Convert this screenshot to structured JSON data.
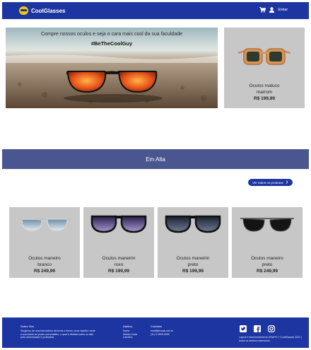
{
  "header": {
    "brand": "CoolGlasses",
    "login_label": "Entrar",
    "color": "#1d35a1"
  },
  "hero": {
    "headline": "Compre nossos oculos e seja o cara mais cool da sua faculdade",
    "hashtag": "#BeTheCoolGuy"
  },
  "featured_side": {
    "name_line1": "Oculos maluco",
    "name_line2": "marrom",
    "price": "R$ 199,99"
  },
  "section": {
    "title": "Em Alta",
    "see_all_label": "Ver todos os produtos"
  },
  "products": [
    {
      "name_line1": "Oculos maneiro",
      "name_line2": "branco",
      "price": "R$ 249,99",
      "style": "aviator-blue"
    },
    {
      "name_line1": "Oculos maneirin",
      "name_line2": "roxo",
      "price": "R$ 199,99",
      "style": "wayfarer-purple"
    },
    {
      "name_line1": "Oculos maneirin",
      "name_line2": "preto",
      "price": "R$ 199,99",
      "style": "wayfarer-black"
    },
    {
      "name_line1": "Oculos maneiro",
      "name_line2": "preto",
      "price": "R$ 249,99",
      "style": "aviator-black"
    }
  ],
  "footer": {
    "about_title": "Sobre Nós",
    "about_text": "Surgimos de uma brincadeira da turma e temos como objetivo vestir a sua mente de jovem universitário, o qual é dividido todos os dias pela universidade e profissões",
    "links_title": "Atalhos",
    "links": [
      "Home",
      "Minha Conta",
      "Carrinho"
    ],
    "contact_title": "Contatos",
    "contact_email": "email@email.com.br",
    "contact_phone": "(11) 9 9999-9999",
    "copyright": "Layout e desenvolvimento GRUPO 7 CoolGlasses 2022 | todos os direitos reservados."
  }
}
